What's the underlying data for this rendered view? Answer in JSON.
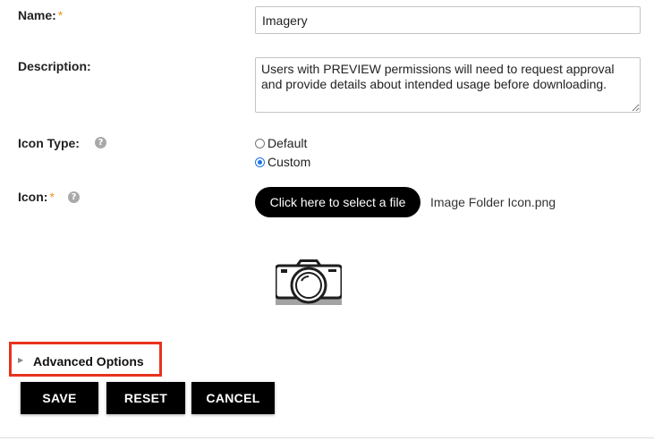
{
  "form": {
    "name": {
      "label": "Name:",
      "required_mark": "*",
      "value": "Imagery"
    },
    "description": {
      "label": "Description:",
      "value": "Users with PREVIEW permissions will need to request approval and provide details about intended usage before downloading."
    },
    "icon_type": {
      "label": "Icon Type:",
      "help_glyph": "?",
      "options": [
        {
          "label": "Default",
          "selected": false
        },
        {
          "label": "Custom",
          "selected": true
        }
      ]
    },
    "icon": {
      "label": "Icon:",
      "required_mark": "*",
      "help_glyph": "?",
      "select_button_label": "Click here to select a file",
      "file_name": "Image Folder Icon.png",
      "preview_icon": "camera-icon"
    }
  },
  "advanced": {
    "arrow_glyph": "▶",
    "label": "Advanced Options"
  },
  "actions": {
    "save_label": "SAVE",
    "reset_label": "RESET",
    "cancel_label": "CANCEL"
  },
  "colors": {
    "required": "#e8951f",
    "highlight_border": "#e8321e",
    "radio_selected": "#1a73e8",
    "button_bg": "#000000"
  }
}
